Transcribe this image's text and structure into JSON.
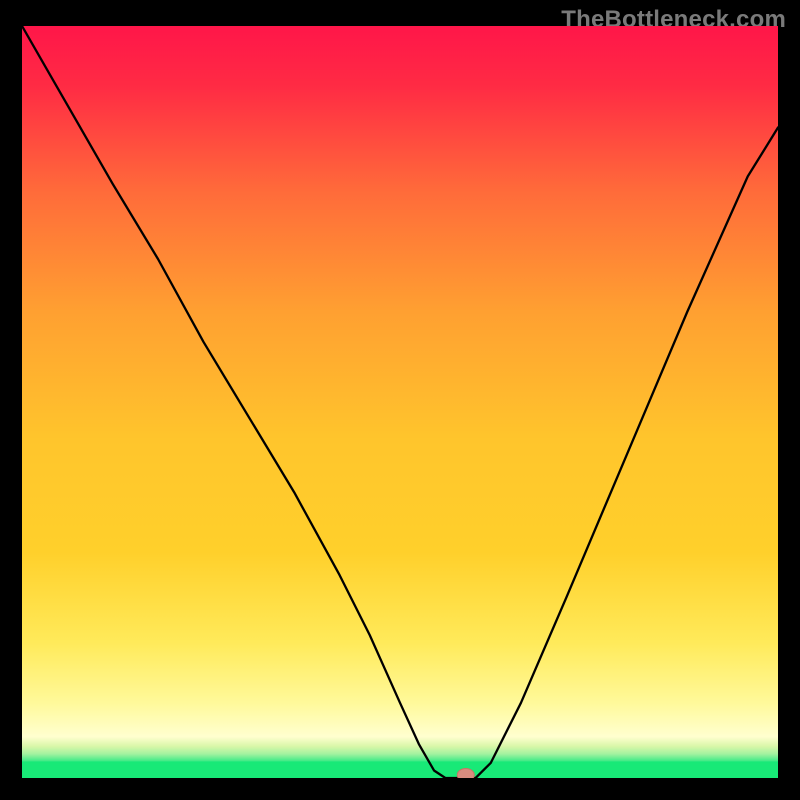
{
  "watermark": "TheBottleneck.com",
  "colors": {
    "top": "#ff1649",
    "mid": "#ffd02b",
    "pale": "#ffffcf",
    "green_band": "#3bea85",
    "green_line": "#18e977",
    "frame": "#000000",
    "curve": "#000000",
    "marker_fill": "#d78c7f",
    "marker_stroke": "#c97465"
  },
  "chart_data": {
    "type": "line",
    "title": "",
    "xlabel": "",
    "ylabel": "",
    "xlim": [
      0,
      100
    ],
    "ylim": [
      0,
      100
    ],
    "series": [
      {
        "name": "curve",
        "x": [
          0,
          4,
          8,
          12,
          18,
          24,
          30,
          36,
          42,
          46,
          50,
          52.5,
          54.5,
          56,
          58,
          60,
          62,
          66,
          72,
          80,
          88,
          96,
          100
        ],
        "y": [
          100,
          93,
          86,
          79,
          69,
          58,
          48,
          38,
          27,
          19,
          10,
          4.5,
          1,
          0,
          0,
          0,
          2,
          10,
          24,
          43,
          62,
          80,
          86.5
        ]
      }
    ],
    "flat_segment": {
      "x_start": 54.5,
      "x_end": 60
    },
    "marker": {
      "x": 58.7,
      "y": 0.4
    },
    "green_band_y": 2.2
  }
}
